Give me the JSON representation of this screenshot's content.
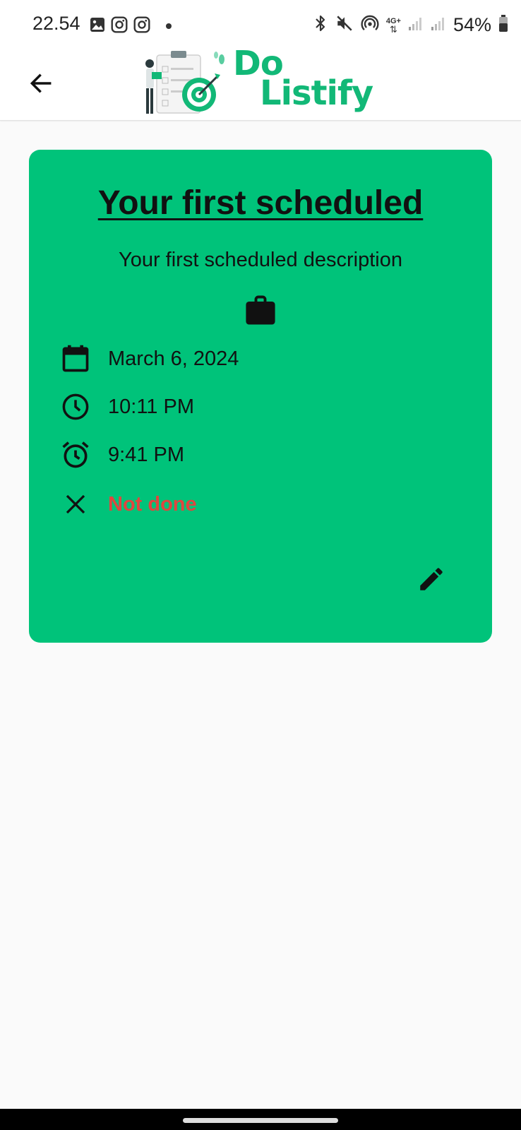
{
  "status_bar": {
    "time": "22.54",
    "battery": "54%",
    "left_icons": [
      "gallery-icon",
      "instagram-icon",
      "instagram-icon",
      "dot-icon"
    ],
    "right_icons": [
      "bluetooth-icon",
      "mute-icon",
      "hotspot-icon",
      "network-4g-icon",
      "signal-icon",
      "signal-icon",
      "battery-icon"
    ],
    "network_label": "4G+"
  },
  "app_bar": {
    "logo_line1": "Do",
    "logo_line2": "Listify",
    "brand_color": "#12b877"
  },
  "card": {
    "background": "#00c37a",
    "title": "Your first scheduled",
    "description": "Your first scheduled description",
    "category_icon": "briefcase-icon",
    "date": "March 6, 2024",
    "time": "10:11 PM",
    "reminder": "9:41 PM",
    "status": "Not done",
    "status_color": "#e0463f"
  }
}
